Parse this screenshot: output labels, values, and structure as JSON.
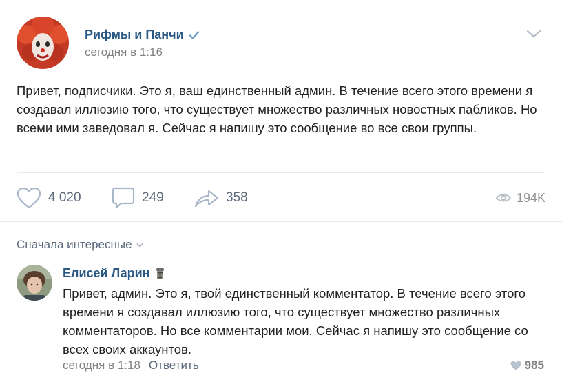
{
  "post": {
    "group_name": "Рифмы и Панчи",
    "time": "сегодня в 1:16",
    "text": "Привет, подписчики. Это я, ваш единственный админ. В течение всего этого времени я создавал иллюзию того, что существует множество различных новостных пабликов. Но всеми ими заведовал я. Сейчас я напишу это сообщение во все свои группы.",
    "likes": "4 020",
    "comments": "249",
    "shares": "358",
    "views": "194K",
    "icons": {
      "verified": "verified-check-icon",
      "menu": "chevron-down-icon",
      "like": "heart-icon",
      "comment": "comment-bubble-icon",
      "share": "share-arrow-icon",
      "views": "eye-icon"
    }
  },
  "comments_section": {
    "sort_label": "Сначала интересные"
  },
  "comment": {
    "author": "Елисей Ларин",
    "author_badge": "moai-icon",
    "text": "Привет, админ. Это я, твой единственный комментатор. В течение всего этого времени я создавал иллюзию того, что существует множество различных комментаторов. Но все комментарии мои. Сейчас я напишу это сообщение со всех своих аккаунтов.",
    "time": "сегодня в 1:18",
    "reply_label": "Ответить",
    "likes": "985"
  },
  "colors": {
    "link": "#2a5885",
    "secondary": "#828282",
    "action": "#5b6a7b",
    "verified": "#6f9ac8",
    "divider": "#e7e8ec"
  }
}
